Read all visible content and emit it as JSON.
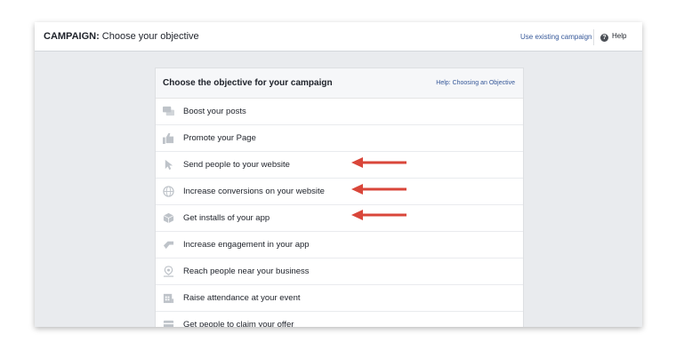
{
  "header": {
    "title_prefix": "CAMPAIGN:",
    "title_text": "Choose your objective",
    "use_existing_label": "Use existing campaign",
    "help_label": "Help"
  },
  "panel": {
    "title": "Choose the objective for your campaign",
    "help_link": "Help: Choosing an Objective"
  },
  "objectives": [
    {
      "label": "Boost your posts",
      "icon": "speech-bubbles-icon"
    },
    {
      "label": "Promote your Page",
      "icon": "thumbs-up-icon"
    },
    {
      "label": "Send people to your website",
      "icon": "cursor-icon",
      "highlighted": true
    },
    {
      "label": "Increase conversions on your website",
      "icon": "globe-icon",
      "highlighted": true
    },
    {
      "label": "Get installs of your app",
      "icon": "cube-icon",
      "highlighted": true
    },
    {
      "label": "Increase engagement in your app",
      "icon": "joystick-icon"
    },
    {
      "label": "Reach people near your business",
      "icon": "location-pin-icon"
    },
    {
      "label": "Raise attendance at your event",
      "icon": "calendar-icon"
    },
    {
      "label": "Get people to claim your offer",
      "icon": "offer-icon"
    }
  ],
  "colors": {
    "arrow": "#d9463a",
    "link": "#365899",
    "icon": "#bec3c9",
    "background": "#e9ebee"
  }
}
